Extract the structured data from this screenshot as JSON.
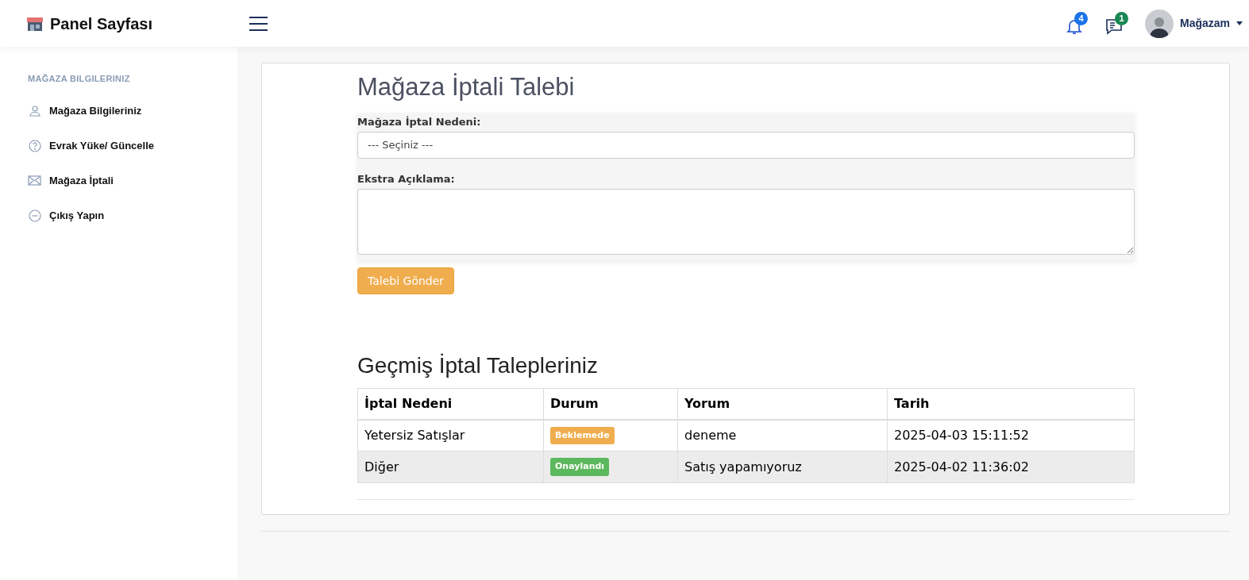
{
  "header": {
    "brand": "Panel Sayfası",
    "notifications": {
      "count": "4"
    },
    "messages": {
      "count": "1"
    },
    "user": {
      "name": "Mağazam"
    }
  },
  "sidebar": {
    "heading": "MAĞAZA BILGILERINIZ",
    "items": [
      {
        "label": "Mağaza Bilgileriniz",
        "kind": "user"
      },
      {
        "label": "Evrak Yüke/ Güncelle",
        "kind": "help"
      },
      {
        "label": "Mağaza İptali",
        "kind": "mail"
      },
      {
        "label": "Çıkış Yapın",
        "kind": "logout"
      }
    ]
  },
  "form": {
    "title": "Mağaza İptali Talebi",
    "reason_label": "Mağaza İptal Nedeni:",
    "reason_value": "--- Seçiniz ---",
    "note_label": "Ekstra Açıklama:",
    "submit": "Talebi Gönder"
  },
  "history": {
    "title": "Geçmiş İptal Talepleriniz",
    "columns": [
      "İptal Nedeni",
      "Durum",
      "Yorum",
      "Tarih"
    ],
    "rows": [
      {
        "reason": "Yetersiz Satışlar",
        "status": "Beklemede",
        "color": "#f0ad4e",
        "comment": "deneme",
        "date": "2025-04-03 15:11:52"
      },
      {
        "reason": "Diğer",
        "status": "Onaylandı",
        "color": "#5cb85c",
        "comment": "Satış yapamıyoruz",
        "date": "2025-04-02 11:36:02"
      }
    ]
  }
}
